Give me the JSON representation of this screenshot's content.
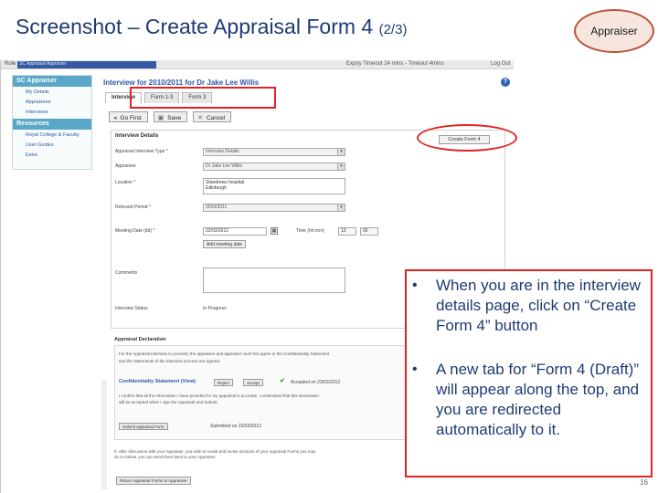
{
  "slide": {
    "title": "Screenshot – Create Appraisal Form 4",
    "title_step": "(2/3)",
    "badge": "Appraiser",
    "page_number": "16"
  },
  "app": {
    "topbar": {
      "role_label": "Role",
      "role_value": "SC Appraisal Appraiser",
      "session": "Expiry Timeout 24 mins - Timeout 4mins",
      "logout": "Log Out"
    },
    "sidebar": {
      "heading": "SC Appraiser",
      "items": [
        "My Details",
        "Appraisees",
        "Interviews"
      ],
      "resources_heading": "Resources",
      "resource_items": [
        "Royal College & Faculty",
        "User Guides",
        "Extra"
      ]
    },
    "page_title": "Interview for 2010/2011 for Dr Jake Lee Willis",
    "tabs": [
      "Interview",
      "Form 1-3",
      "Form 3"
    ],
    "toolbar": {
      "go_first": "Go First",
      "save": "Save",
      "cancel": "Cancel"
    },
    "details": {
      "heading": "Interview Details",
      "create_form_button": "Create Form 4",
      "fields": {
        "interview_type_label": "Appraisal Interview Type *",
        "interview_type_value": "Interview Details",
        "appraisee_label": "Appraisee",
        "appraisee_value": "Dr Jake Lee Willis",
        "location_label": "Location *",
        "location_line1": "Standrews hospital",
        "location_line2": "Edinburgh",
        "year_label": "Relevant Period *",
        "year_value": "2010/2011",
        "meeting_label": "Meeting Date (dd) *",
        "meeting_value": "22/03/2012",
        "time_label": "Time (hh:mm)",
        "hour_value": "13",
        "minute_value": "00",
        "add_meeting_button": "Add meeting date",
        "comments_label": "Comments",
        "status_label": "Interview Status",
        "status_value": "In Progress"
      }
    },
    "declaration": {
      "heading": "Appraisal Declaration",
      "intro_line1": "For the Appraisal interview to proceed, the appraisee and appraiser must first agree to the Confidentiality Statement",
      "intro_line2": "and the statements of the interview process are agreed.",
      "confidentiality_label": "Confidentiality Statement (View)",
      "reject_label": "Reject",
      "accept_label": "Accept",
      "accepted_text": "Accepted on 23/03/2012",
      "line3": "I confirm that all the information I have provided for my appraisal is accurate. I understand that this declaration",
      "line4": "will be accepted when I sign the Appraisal and Submit.",
      "submit_button": "Submit Appraisal Form",
      "submit_text": "Submitted on 23/03/2012"
    },
    "footer_note_line1": "If, after discussion with your Appraiser, you wish to revisit and revise sections of your Appraisal Forms you may",
    "footer_note_line2": "do so below, you can send them back to your Appraiser.",
    "footer_button": "Return Appraisal Forms to Appraisee"
  },
  "callout": {
    "bullets": [
      "When you are in the interview details page, click on “Create Form 4” button",
      "A new tab for “Form 4 (Draft)” will appear along the top, and you are redirected automatically to it."
    ]
  },
  "colors": {
    "title": "#1f3a73",
    "highlight": "#e02424",
    "app_link": "#2d57a8",
    "sidebar_head": "#5aa7c8"
  }
}
